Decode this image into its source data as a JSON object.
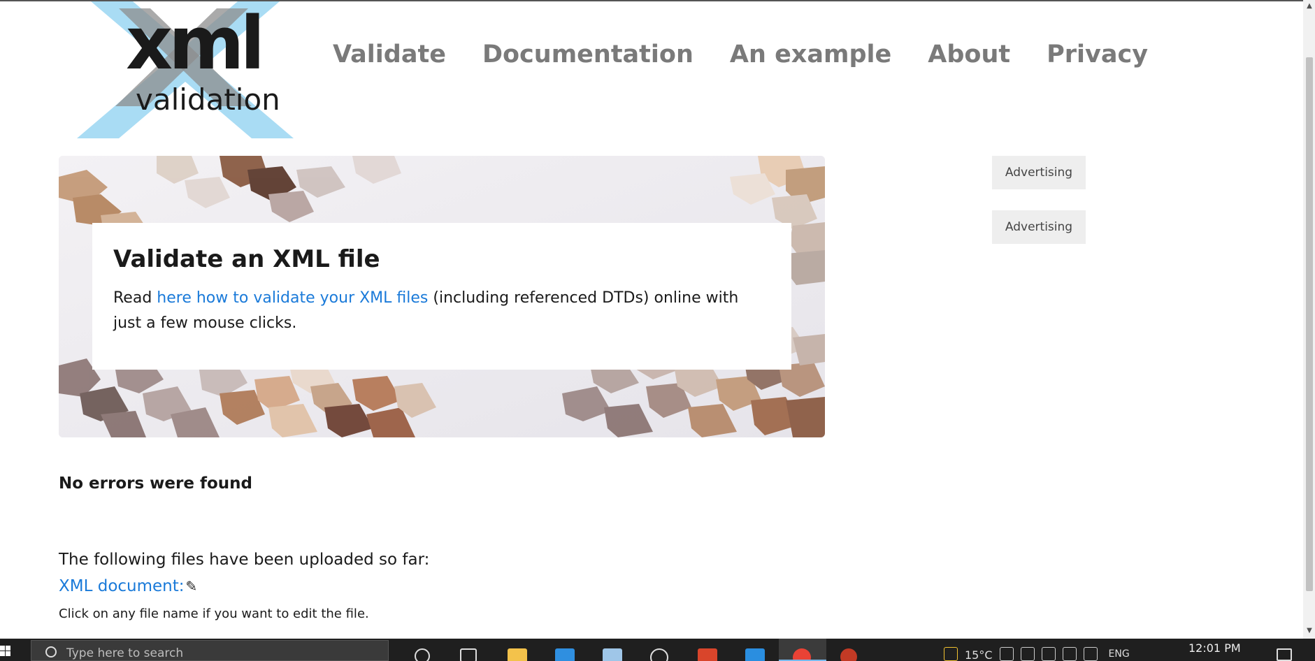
{
  "logo": {
    "main": "xml",
    "sub": "validation"
  },
  "nav": {
    "items": [
      {
        "label": "Validate"
      },
      {
        "label": "Documentation"
      },
      {
        "label": "An example"
      },
      {
        "label": "About"
      },
      {
        "label": "Privacy"
      }
    ]
  },
  "hero": {
    "title": "Validate an XML file",
    "text_before": "Read ",
    "link_text": "here how to validate your XML files",
    "text_after": " (including referenced DTDs) online with just a few mouse clicks."
  },
  "ads": [
    {
      "label": "Advertising"
    },
    {
      "label": "Advertising"
    }
  ],
  "results": {
    "heading": "No errors were found",
    "uploaded_intro": "The following files have been uploaded so far:",
    "file_label": "XML document:",
    "file_edit_icon": "pencil-icon",
    "hint": "Click on any file name if you want to edit the file."
  },
  "taskbar": {
    "search_placeholder": "Type here to search",
    "weather": "15°C",
    "language": "ENG",
    "time": "12:01 PM"
  },
  "colors": {
    "nav_text": "#7a7a7a",
    "link": "#1a7ad9",
    "logo_x": "#a9dcf4",
    "logo_x_dark": "#8b8b8b"
  }
}
